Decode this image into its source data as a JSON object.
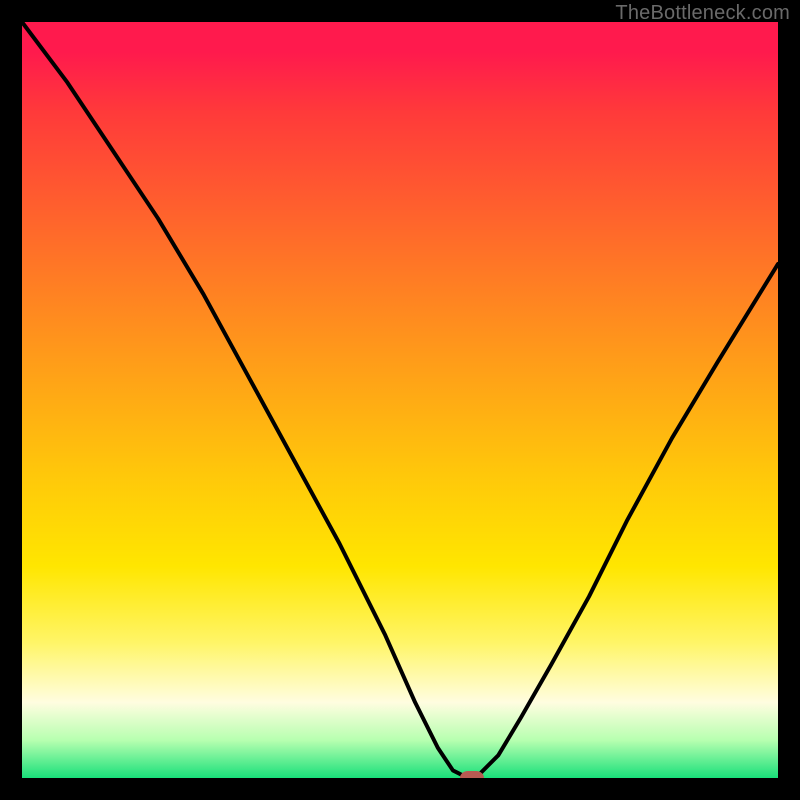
{
  "watermark": {
    "text": "TheBottleneck.com"
  },
  "chart_data": {
    "type": "line",
    "title": "",
    "xlabel": "",
    "ylabel": "",
    "xlim": [
      0,
      100
    ],
    "ylim": [
      0,
      100
    ],
    "grid": false,
    "legend": false,
    "background_gradient_top_color": "#ff1a4d",
    "background_gradient_bottom_color": "#19e07a",
    "series": [
      {
        "name": "bottleneck-curve",
        "x": [
          0,
          6,
          12,
          18,
          24,
          30,
          36,
          42,
          48,
          52,
          55,
          57,
          59,
          60,
          63,
          66,
          70,
          75,
          80,
          86,
          92,
          100
        ],
        "y": [
          100,
          92,
          83,
          74,
          64,
          53,
          42,
          31,
          19,
          10,
          4,
          1,
          0,
          0,
          3,
          8,
          15,
          24,
          34,
          45,
          55,
          68
        ]
      }
    ],
    "marker": {
      "x": 59.5,
      "y": 0,
      "color": "#b85a52"
    }
  }
}
